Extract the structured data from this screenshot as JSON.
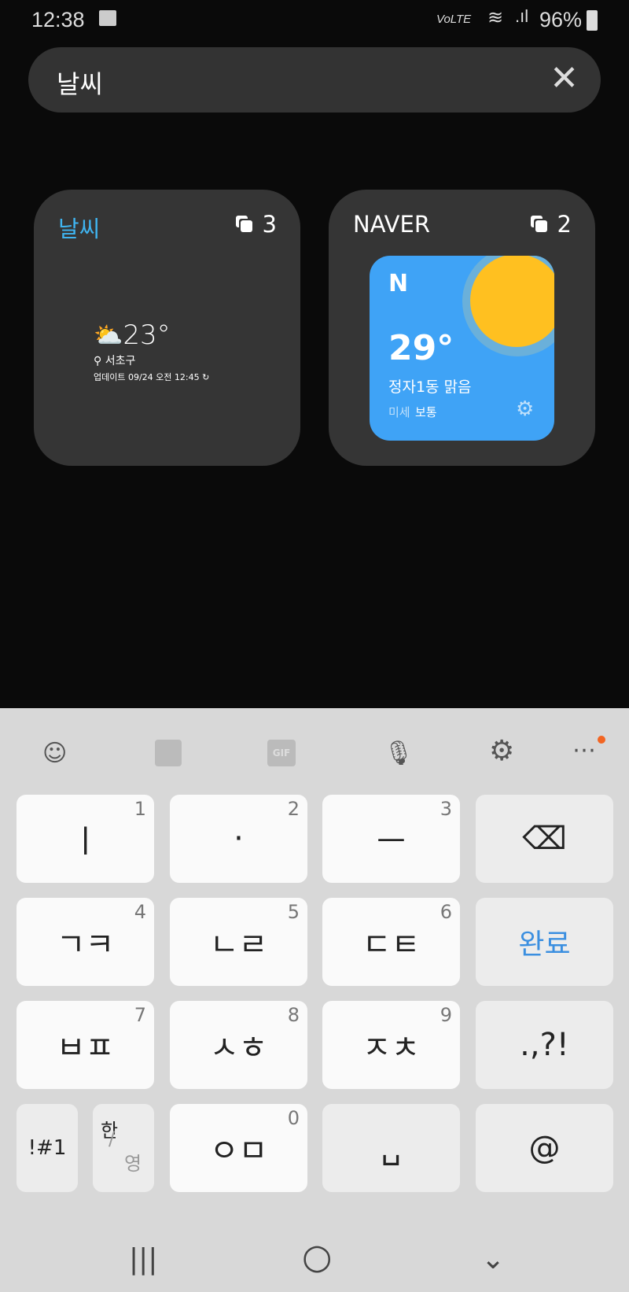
{
  "status": {
    "time": "12:38",
    "battery": "96%",
    "network": "VoLTE",
    "icons": [
      "gallery-icon",
      "mute-icon",
      "wifi-icon",
      "signal-icon",
      "battery-icon"
    ]
  },
  "search": {
    "query": "날씨",
    "clear_icon": "close-icon"
  },
  "cards": [
    {
      "title": "날씨",
      "count": "3",
      "temp": "23°",
      "location": "서초구",
      "updated": "업데이트 09/24 오전 12:45"
    },
    {
      "title": "NAVER",
      "count": "2",
      "logo": "N",
      "temp": "29°",
      "desc": "정자1동 맑음",
      "dust_label": "미세",
      "dust_value": "보통"
    }
  ],
  "colors": {
    "accent": "#3fb4f0",
    "naver_bg": "#3fa3f6",
    "sun": "#ffc020"
  },
  "keyboard": {
    "toolbar": [
      "emoji-icon",
      "sticker-icon",
      "gif-icon",
      "mic-icon",
      "settings-icon",
      "more-icon"
    ],
    "gif": "GIF",
    "keys": [
      {
        "label": "ㅣ",
        "num": "1"
      },
      {
        "label": "·",
        "num": "2"
      },
      {
        "label": "ㅡ",
        "num": "3"
      },
      {
        "label": "⌫",
        "num": ""
      },
      {
        "label": "ㄱㅋ",
        "num": "4"
      },
      {
        "label": "ㄴㄹ",
        "num": "5"
      },
      {
        "label": "ㄷㅌ",
        "num": "6"
      },
      {
        "label": "완료",
        "num": ""
      },
      {
        "label": "ㅂㅍ",
        "num": "7"
      },
      {
        "label": "ㅅㅎ",
        "num": "8"
      },
      {
        "label": "ㅈㅊ",
        "num": "9"
      },
      {
        "label": ".,?!",
        "num": ""
      },
      {
        "label": "ㅇㅁ",
        "num": "0"
      },
      {
        "label": "␣",
        "num": ""
      },
      {
        "label": "@",
        "num": ""
      }
    ],
    "sym": "!#1",
    "lang_top": "한",
    "lang_bottom": "영"
  },
  "nav": {
    "recent": "|||",
    "home": "○",
    "back": "⌄"
  }
}
